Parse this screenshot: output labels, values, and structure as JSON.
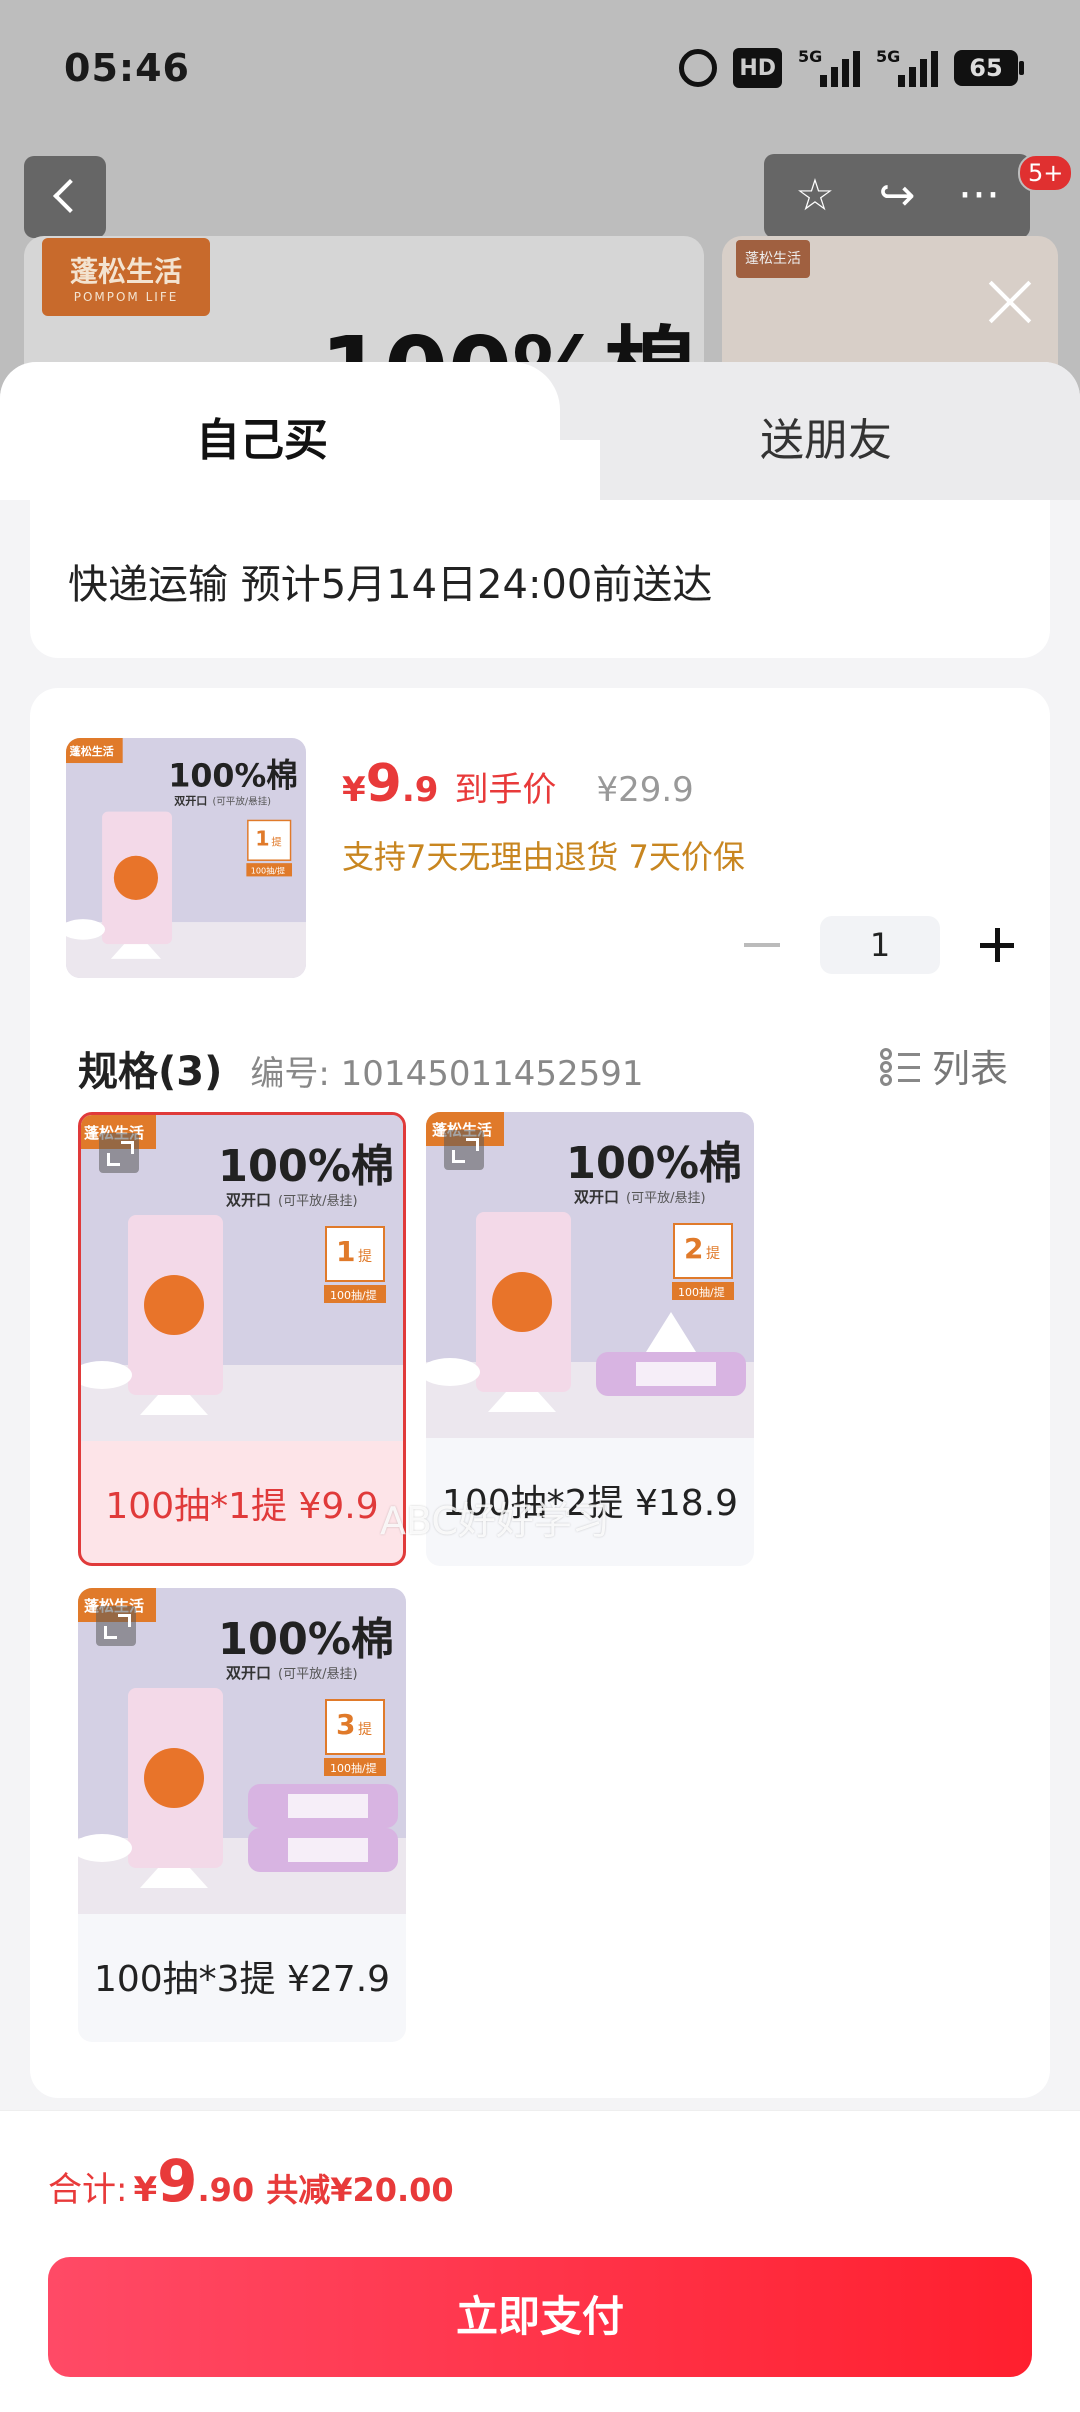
{
  "status_bar": {
    "time": "05:46",
    "hd": "HD",
    "net1": "5G",
    "net2": "5G",
    "battery": "65"
  },
  "background": {
    "brand_cn": "蓬松生活",
    "brand_en": "POMPOM LIFE",
    "banner_title": "100%棉",
    "badge": "5+",
    "icons": [
      "back-icon",
      "star-icon",
      "share-icon",
      "more-icon",
      "close-icon"
    ]
  },
  "tabs": {
    "self": "自己买",
    "gift": "送朋友"
  },
  "delivery": "快递运输 预计5月14日24:00前送达",
  "product": {
    "price_currency": "¥",
    "price_int": "9",
    "price_dec": ".9",
    "price_tag": "到手价",
    "original_price": "¥29.9",
    "promises": "支持7天无理由退货 7天价保",
    "quantity": "1"
  },
  "spec": {
    "title": "规格(3)",
    "code": "编号: 10145011452591",
    "view_label": "列表",
    "variants": [
      {
        "label": "100抽*1提 ¥9.9",
        "pack": "1",
        "selected": true
      },
      {
        "label": "100抽*2提 ¥18.9",
        "pack": "2",
        "selected": false
      },
      {
        "label": "100抽*3提 ¥27.9",
        "pack": "3",
        "selected": false
      }
    ]
  },
  "image_text": {
    "headline": "100%棉",
    "sub": "双开口",
    "sub_note": "(可平放/悬挂)",
    "pack_unit": "提",
    "count": "100抽/提",
    "brand": "蓬松生活"
  },
  "watermark": "ABC好好学习",
  "footer": {
    "total_label": "合计:",
    "total_currency": "¥",
    "total_int": "9",
    "total_dec": ".90",
    "savings": "共减¥20.00",
    "pay_button": "立即支付"
  },
  "colors": {
    "accent": "#e83a3a",
    "promise": "#c88620",
    "pay_gradient_start": "#ff4a66",
    "pay_gradient_end": "#ff1f2e"
  }
}
